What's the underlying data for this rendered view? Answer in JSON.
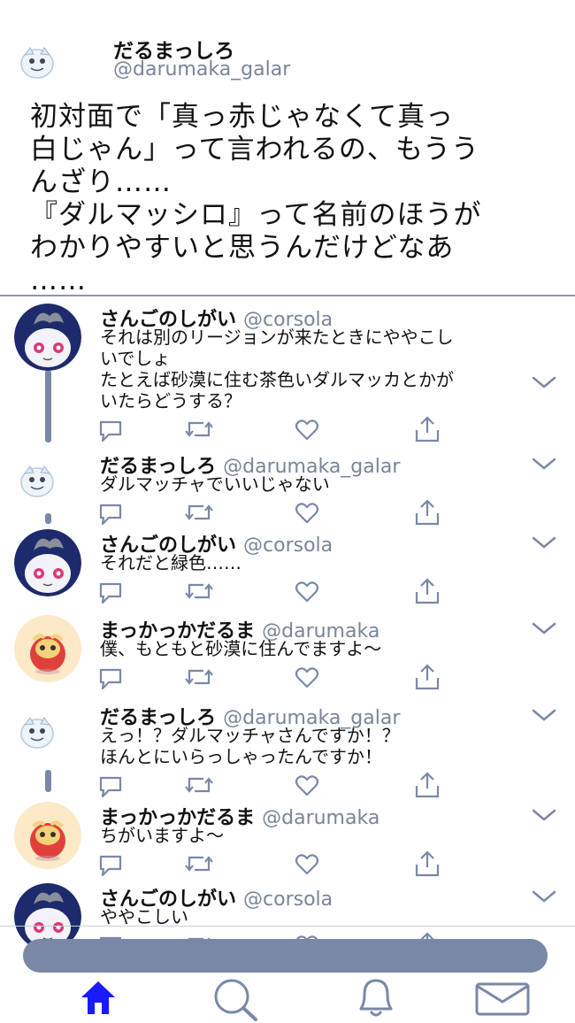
{
  "header": {
    "display_name": "だるまっしろ",
    "handle": "@darumaka_galar",
    "tweet_lines": [
      "初対面で「真っ赤じゃなくて真っ",
      "白じゃん」って言われるの、もうう",
      "んざり……",
      "『ダルマッシロ』って名前のほうが",
      "わかりやすいと思うんだけどなあ",
      "……"
    ]
  },
  "replies": [
    {
      "name": "さんごのしがい",
      "handle": "@corsola",
      "avatar": "corsola",
      "lines": [
        "それは別のリージョンが来たときにややこし",
        "いでしょ",
        "たとえば砂漠に住む茶色いダルマッカとかが",
        "いたらどうする？"
      ]
    },
    {
      "name": "だるまっしろ",
      "handle": "@darumaka_galar",
      "avatar": "galar",
      "lines": [
        "ダルマッチャでいいじゃない"
      ]
    },
    {
      "name": "さんごのしがい",
      "handle": "@corsola",
      "avatar": "corsola",
      "lines": [
        "それだと緑色……"
      ]
    },
    {
      "name": "まっかっかだるま",
      "handle": "@darumaka",
      "avatar": "darumaka",
      "lines": [
        "僕、もともと砂漠に住んでますよ～"
      ]
    },
    {
      "name": "だるまっしろ",
      "handle": "@darumaka_galar",
      "avatar": "galar",
      "lines": [
        "えっ！？ダルマッチャさんですか！？",
        "ほんとにいらっしゃったんですか！"
      ]
    },
    {
      "name": "まっかっかだるま",
      "handle": "@darumaka",
      "avatar": "darumaka",
      "lines": [
        "ちがいますよ～"
      ]
    },
    {
      "name": "さんごのしがい",
      "handle": "@corsola",
      "avatar": "corsola",
      "lines": [
        "ややこしい"
      ]
    }
  ],
  "action_icons": [
    "reply-icon",
    "retweet-icon",
    "like-icon",
    "share-icon"
  ],
  "bottom_nav": [
    "home-icon",
    "search-icon",
    "notifications-icon",
    "messages-icon"
  ],
  "colors": {
    "accent": "#1a1aff",
    "muted": "#7a88a8",
    "text": "#111111"
  }
}
